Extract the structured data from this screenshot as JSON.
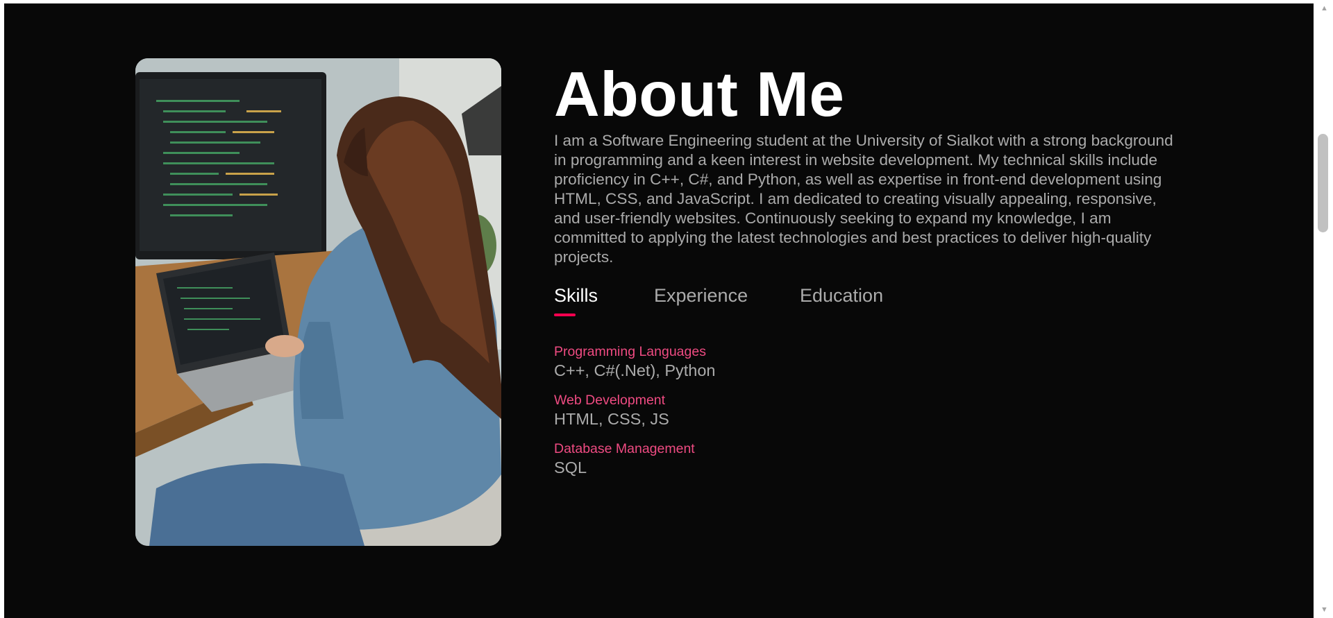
{
  "about": {
    "title": "About Me",
    "intro": "I am a Software Engineering student at the University of Sialkot with a strong background in programming and a keen interest in website development. My technical skills include proficiency in C++, C#, and Python, as well as expertise in front-end development using HTML, CSS, and JavaScript. I am dedicated to creating visually appealing, responsive, and user-friendly websites. Continuously seeking to expand my knowledge, I am committed to applying the latest technologies and best practices to deliver high-quality projects."
  },
  "tabs": [
    {
      "label": "Skills",
      "active": true
    },
    {
      "label": "Experience",
      "active": false
    },
    {
      "label": "Education",
      "active": false
    }
  ],
  "skills": [
    {
      "category": "Programming Languages",
      "value": "C++, C#(.Net), Python"
    },
    {
      "category": "Web Development",
      "value": "HTML, CSS, JS"
    },
    {
      "category": "Database Management",
      "value": "SQL"
    }
  ],
  "colors": {
    "background": "#080808",
    "accent": "#ff004f",
    "category_text": "#ef4b82",
    "body_text": "#ababab",
    "heading_text": "#ffffff"
  },
  "icons": {
    "scroll_up": "triangle-up-icon",
    "scroll_down": "triangle-down-icon"
  },
  "scroll_glyphs": {
    "up": "▲",
    "down": "▼"
  }
}
